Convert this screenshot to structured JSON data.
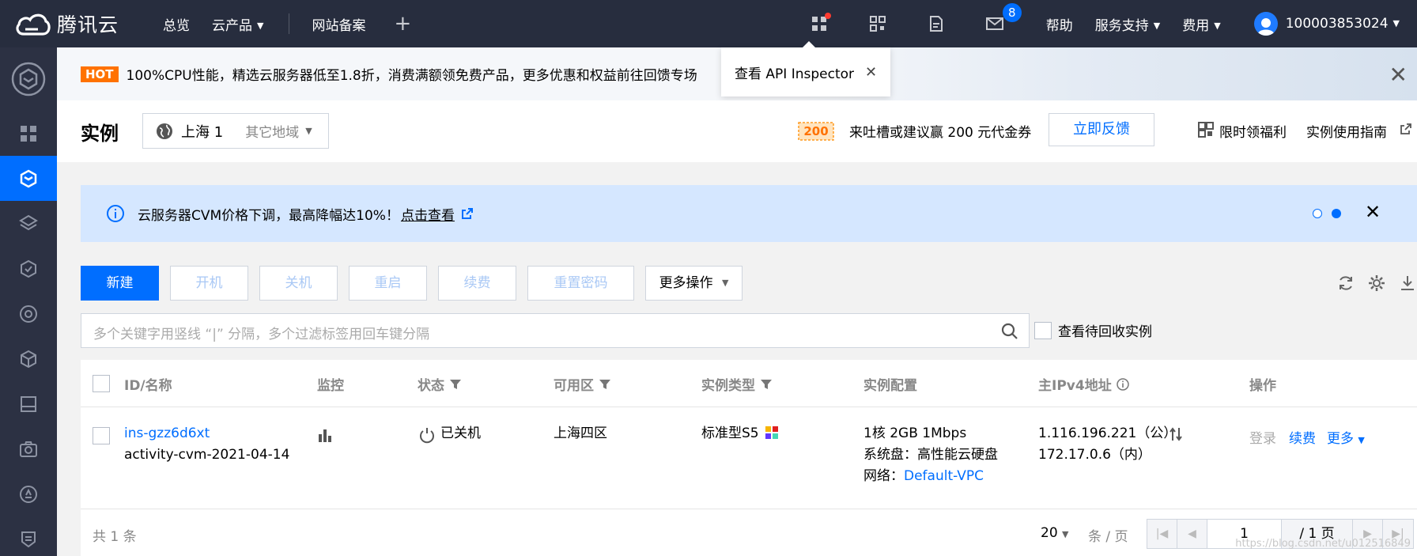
{
  "topbar": {
    "brand": "腾讯云",
    "nav": [
      "总览",
      "云产品",
      "网站备案"
    ],
    "mail_count": "8",
    "help": "帮助",
    "support": "服务支持",
    "billing": "费用",
    "account": "100003853024"
  },
  "hot_banner": {
    "tag": "HOT",
    "text": "100%CPU性能，精选云服务器低至1.8折，消费满额领免费产品，更多优惠和权益前往回馈专场"
  },
  "api_tip": {
    "text": "查看 API Inspector"
  },
  "header": {
    "title": "实例",
    "region": "上海 1",
    "other_region": "其它地域",
    "promo_badge": "200",
    "promo_text": "来吐槽或建议赢 200 元代金券",
    "feedback_button": "立即反馈",
    "gift": "限时领福利",
    "guide": "实例使用指南"
  },
  "notice": {
    "text": "云服务器CVM价格下调，最高降幅达10%！",
    "link": "点击查看"
  },
  "toolbar": {
    "create": "新建",
    "start": "开机",
    "stop": "关机",
    "restart": "重启",
    "renew": "续费",
    "reset_password": "重置密码",
    "more": "更多操作"
  },
  "search": {
    "placeholder": "多个关键字用竖线 “|” 分隔，多个过滤标签用回车键分隔",
    "recycle_label": "查看待回收实例"
  },
  "table": {
    "columns": [
      "ID/名称",
      "监控",
      "状态",
      "可用区",
      "实例类型",
      "实例配置",
      "主IPv4地址",
      "操作"
    ],
    "rows": [
      {
        "id": "ins-gzz6d6xt",
        "name": "activity-cvm-2021-04-14",
        "status": "已关机",
        "zone": "上海四区",
        "type": "标准型S5",
        "config_line1": "1核 2GB 1Mbps",
        "config_line2": "系统盘：高性能云硬盘",
        "config_line3_label": "网络：",
        "config_line3_link": "Default-VPC",
        "ip_public": "1.116.196.221（公）",
        "ip_private": "172.17.0.6（内）",
        "op_login": "登录",
        "op_renew": "续费",
        "op_more": "更多"
      }
    ]
  },
  "footer": {
    "total": "共 1 条",
    "page_size": "20",
    "per_page": "条 / 页",
    "page": "1",
    "page_total": "/ 1 页",
    "watermark": "https://blog.csdn.net/u012516849"
  }
}
